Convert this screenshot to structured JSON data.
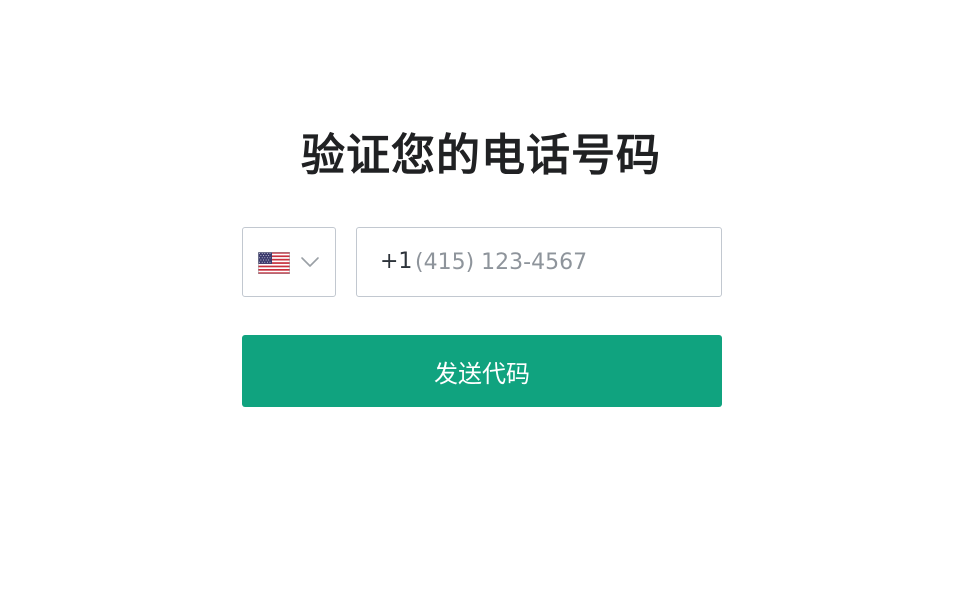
{
  "heading": {
    "title": "验证您的电话号码"
  },
  "country_selector": {
    "flag_icon": "us-flag-icon",
    "chevron_icon": "chevron-down-icon"
  },
  "phone": {
    "dial_code": "+1",
    "value": "",
    "placeholder": "(415) 123-4567"
  },
  "actions": {
    "send_code_label": "发送代码"
  },
  "colors": {
    "primary": "#10a37f",
    "title_text": "#202123",
    "border": "#c2c8d0",
    "placeholder": "#8e949b"
  }
}
